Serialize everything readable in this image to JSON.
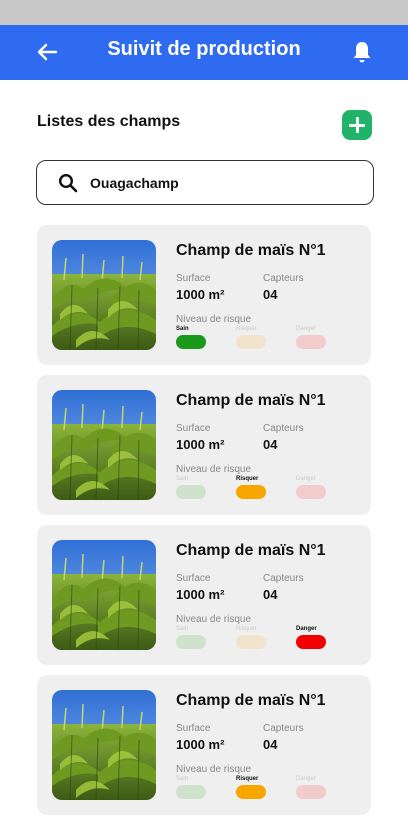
{
  "header": {
    "title": "Suivit de production",
    "back_icon": "arrow-left-icon",
    "notification_icon": "bell-icon",
    "bar_color": "#2f6bf0"
  },
  "list": {
    "title": "Listes des champs",
    "add_icon": "plus-icon",
    "add_color": "#22b36a"
  },
  "search": {
    "icon": "search-icon",
    "value": "Ouagachamp"
  },
  "fields": [
    {
      "name": "Champ de maïs N°1",
      "surface_label": "Surface",
      "surface": "1000 m²",
      "sensors_label": "Capteurs",
      "sensors": "04",
      "risk_label": "Niveau de risque",
      "risk_level": "Sain",
      "levels": [
        "Sain",
        "Risquer",
        "Danger"
      ]
    },
    {
      "name": "Champ de maïs N°1",
      "surface_label": "Surface",
      "surface": "1000 m²",
      "sensors_label": "Capteurs",
      "sensors": "04",
      "risk_label": "Niveau de risque",
      "risk_level": "Risquer",
      "levels": [
        "Sain",
        "Risquer",
        "Danger"
      ]
    },
    {
      "name": "Champ de maïs N°1",
      "surface_label": "Surface",
      "surface": "1000 m²",
      "sensors_label": "Capteurs",
      "sensors": "04",
      "risk_label": "Niveau de risque",
      "risk_level": "Danger",
      "levels": [
        "Sain",
        "Risquer",
        "Danger"
      ]
    },
    {
      "name": "Champ de maïs N°1",
      "surface_label": "Surface",
      "surface": "1000 m²",
      "sensors_label": "Capteurs",
      "sensors": "04",
      "risk_label": "Niveau de risque",
      "risk_level": "Risquer",
      "levels": [
        "Sain",
        "Risquer",
        "Danger"
      ]
    }
  ],
  "risk_colors": {
    "Sain": {
      "active": "#1a9a1a",
      "inactive": "#cfe3cc"
    },
    "Risquer": {
      "active": "#f7a600",
      "inactive": "#f1e3cc"
    },
    "Danger": {
      "active": "#f20000",
      "inactive": "#f2cccc"
    }
  }
}
